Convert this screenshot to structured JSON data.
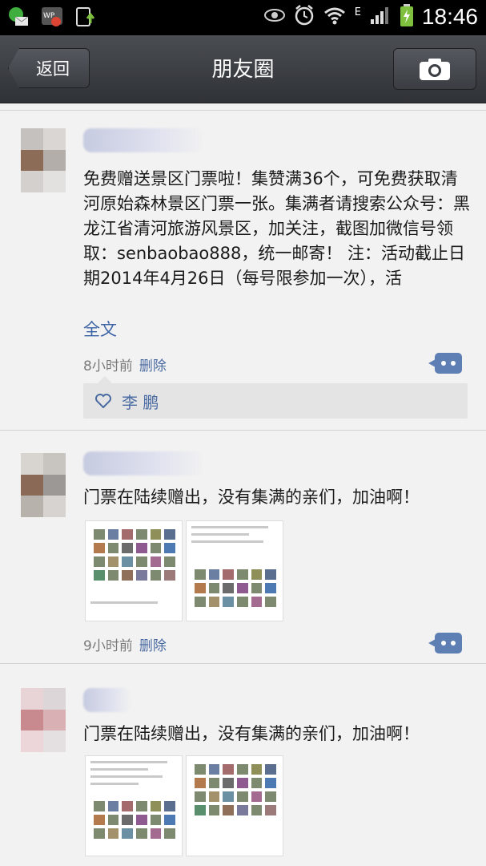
{
  "status_bar": {
    "time": "18:46",
    "network_letter": "E",
    "icons": [
      "message-notification-icon",
      "app-notification-icon",
      "install-notification-icon",
      "eye-icon",
      "alarm-icon",
      "wifi-icon",
      "signal-icon",
      "battery-charging-icon"
    ]
  },
  "title_bar": {
    "back_label": "返回",
    "title": "朋友圈",
    "camera_icon": "camera-icon"
  },
  "posts": [
    {
      "text": "免费赠送景区门票啦！集赞满36个，可免费获取清河原始森林景区门票一张。集满者请搜索公众号：黑龙江省清河旅游风景区，加关注，截图加微信号领取：senbaobao888，统一邮寄！ 注：活动截止日期2014年4月26日（每号限参加一次），活",
      "full_text_link": "全文",
      "time": "8小时前",
      "delete_label": "删除",
      "likes": "李 鹏"
    },
    {
      "text": "门票在陆续赠出，没有集满的亲们，加油啊！",
      "time": "9小时前",
      "delete_label": "删除"
    },
    {
      "text": "门票在陆续赠出，没有集满的亲们，加油啊！"
    }
  ],
  "colors": {
    "titlebar": "#3a3d42",
    "link_blue": "#3d64a6",
    "comment_button": "#5d7fb4",
    "background": "#f2f2f2"
  }
}
